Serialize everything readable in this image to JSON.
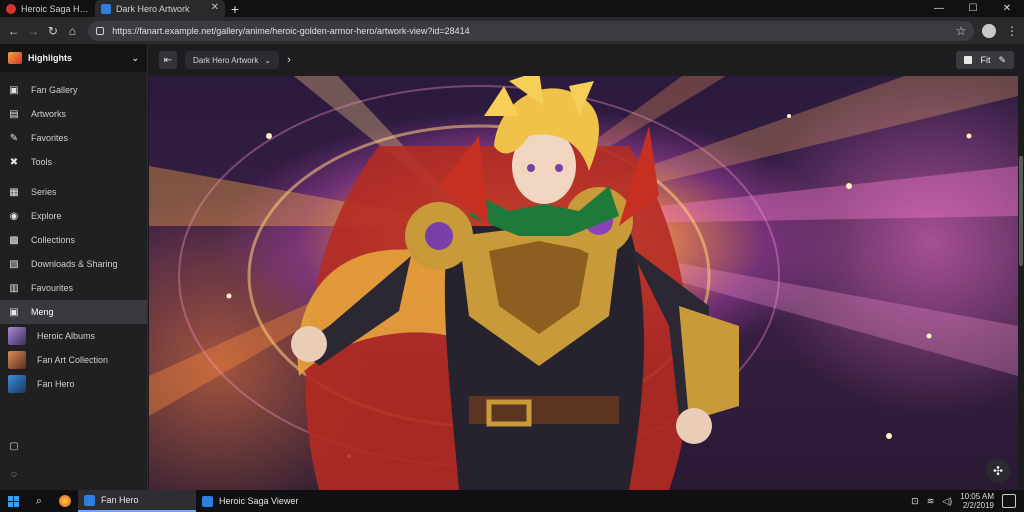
{
  "browser": {
    "tabs": [
      {
        "title": "Heroic Saga Hub",
        "favicon_color": "#d9342b",
        "active": false
      },
      {
        "title": "Dark Hero Artwork",
        "favicon_color": "#2d7ee0",
        "active": true
      }
    ],
    "new_tab_label": "+",
    "window_controls": {
      "minimize": "—",
      "maximize": "☐",
      "close": "✕"
    },
    "url": "https://fanart.example.net/gallery/anime/heroic-golden-armor-hero/artwork-view?id=28414",
    "icons": {
      "back": "back-arrow-icon",
      "forward": "forward-arrow-icon",
      "reload": "reload-icon",
      "home": "home-icon",
      "bookmark": "star-icon"
    }
  },
  "sidebar": {
    "title": "Highlights",
    "items": [
      {
        "label": "Fan Gallery",
        "icon": "▣"
      },
      {
        "label": "Artworks",
        "icon": "▤"
      },
      {
        "label": "Favorites",
        "icon": "✎"
      },
      {
        "label": "Tools",
        "icon": "✖"
      },
      {
        "label": "Series",
        "icon": "▦"
      },
      {
        "label": "Explore",
        "icon": "◉"
      },
      {
        "label": "Collections",
        "icon": "▩"
      },
      {
        "label": "Downloads & Sharing",
        "icon": "▧"
      },
      {
        "label": "Favourites",
        "icon": "▥"
      },
      {
        "label": "Meng",
        "icon": "▣",
        "active": true
      }
    ],
    "recent": [
      {
        "label": "Heroic Albums",
        "color": "#a98bd6"
      },
      {
        "label": "Fan Art Collection",
        "color": "#d98e5b"
      },
      {
        "label": "Fan Hero",
        "color": "#3b8fe0"
      }
    ],
    "bottom_icons": [
      "▢",
      "◌"
    ]
  },
  "toolbar": {
    "crumb": "Dark Hero Artwork",
    "crumb_arrow": "›",
    "right_button": "Fit",
    "edit_icon": "✎"
  },
  "fab_icon": "✣",
  "taskbar": {
    "apps": [
      {
        "label": "Fan Hero",
        "active": true
      },
      {
        "label": "Heroic Saga Viewer",
        "active": false
      }
    ],
    "clock": {
      "time": "10:05 AM",
      "date": "2/2/2019"
    }
  }
}
